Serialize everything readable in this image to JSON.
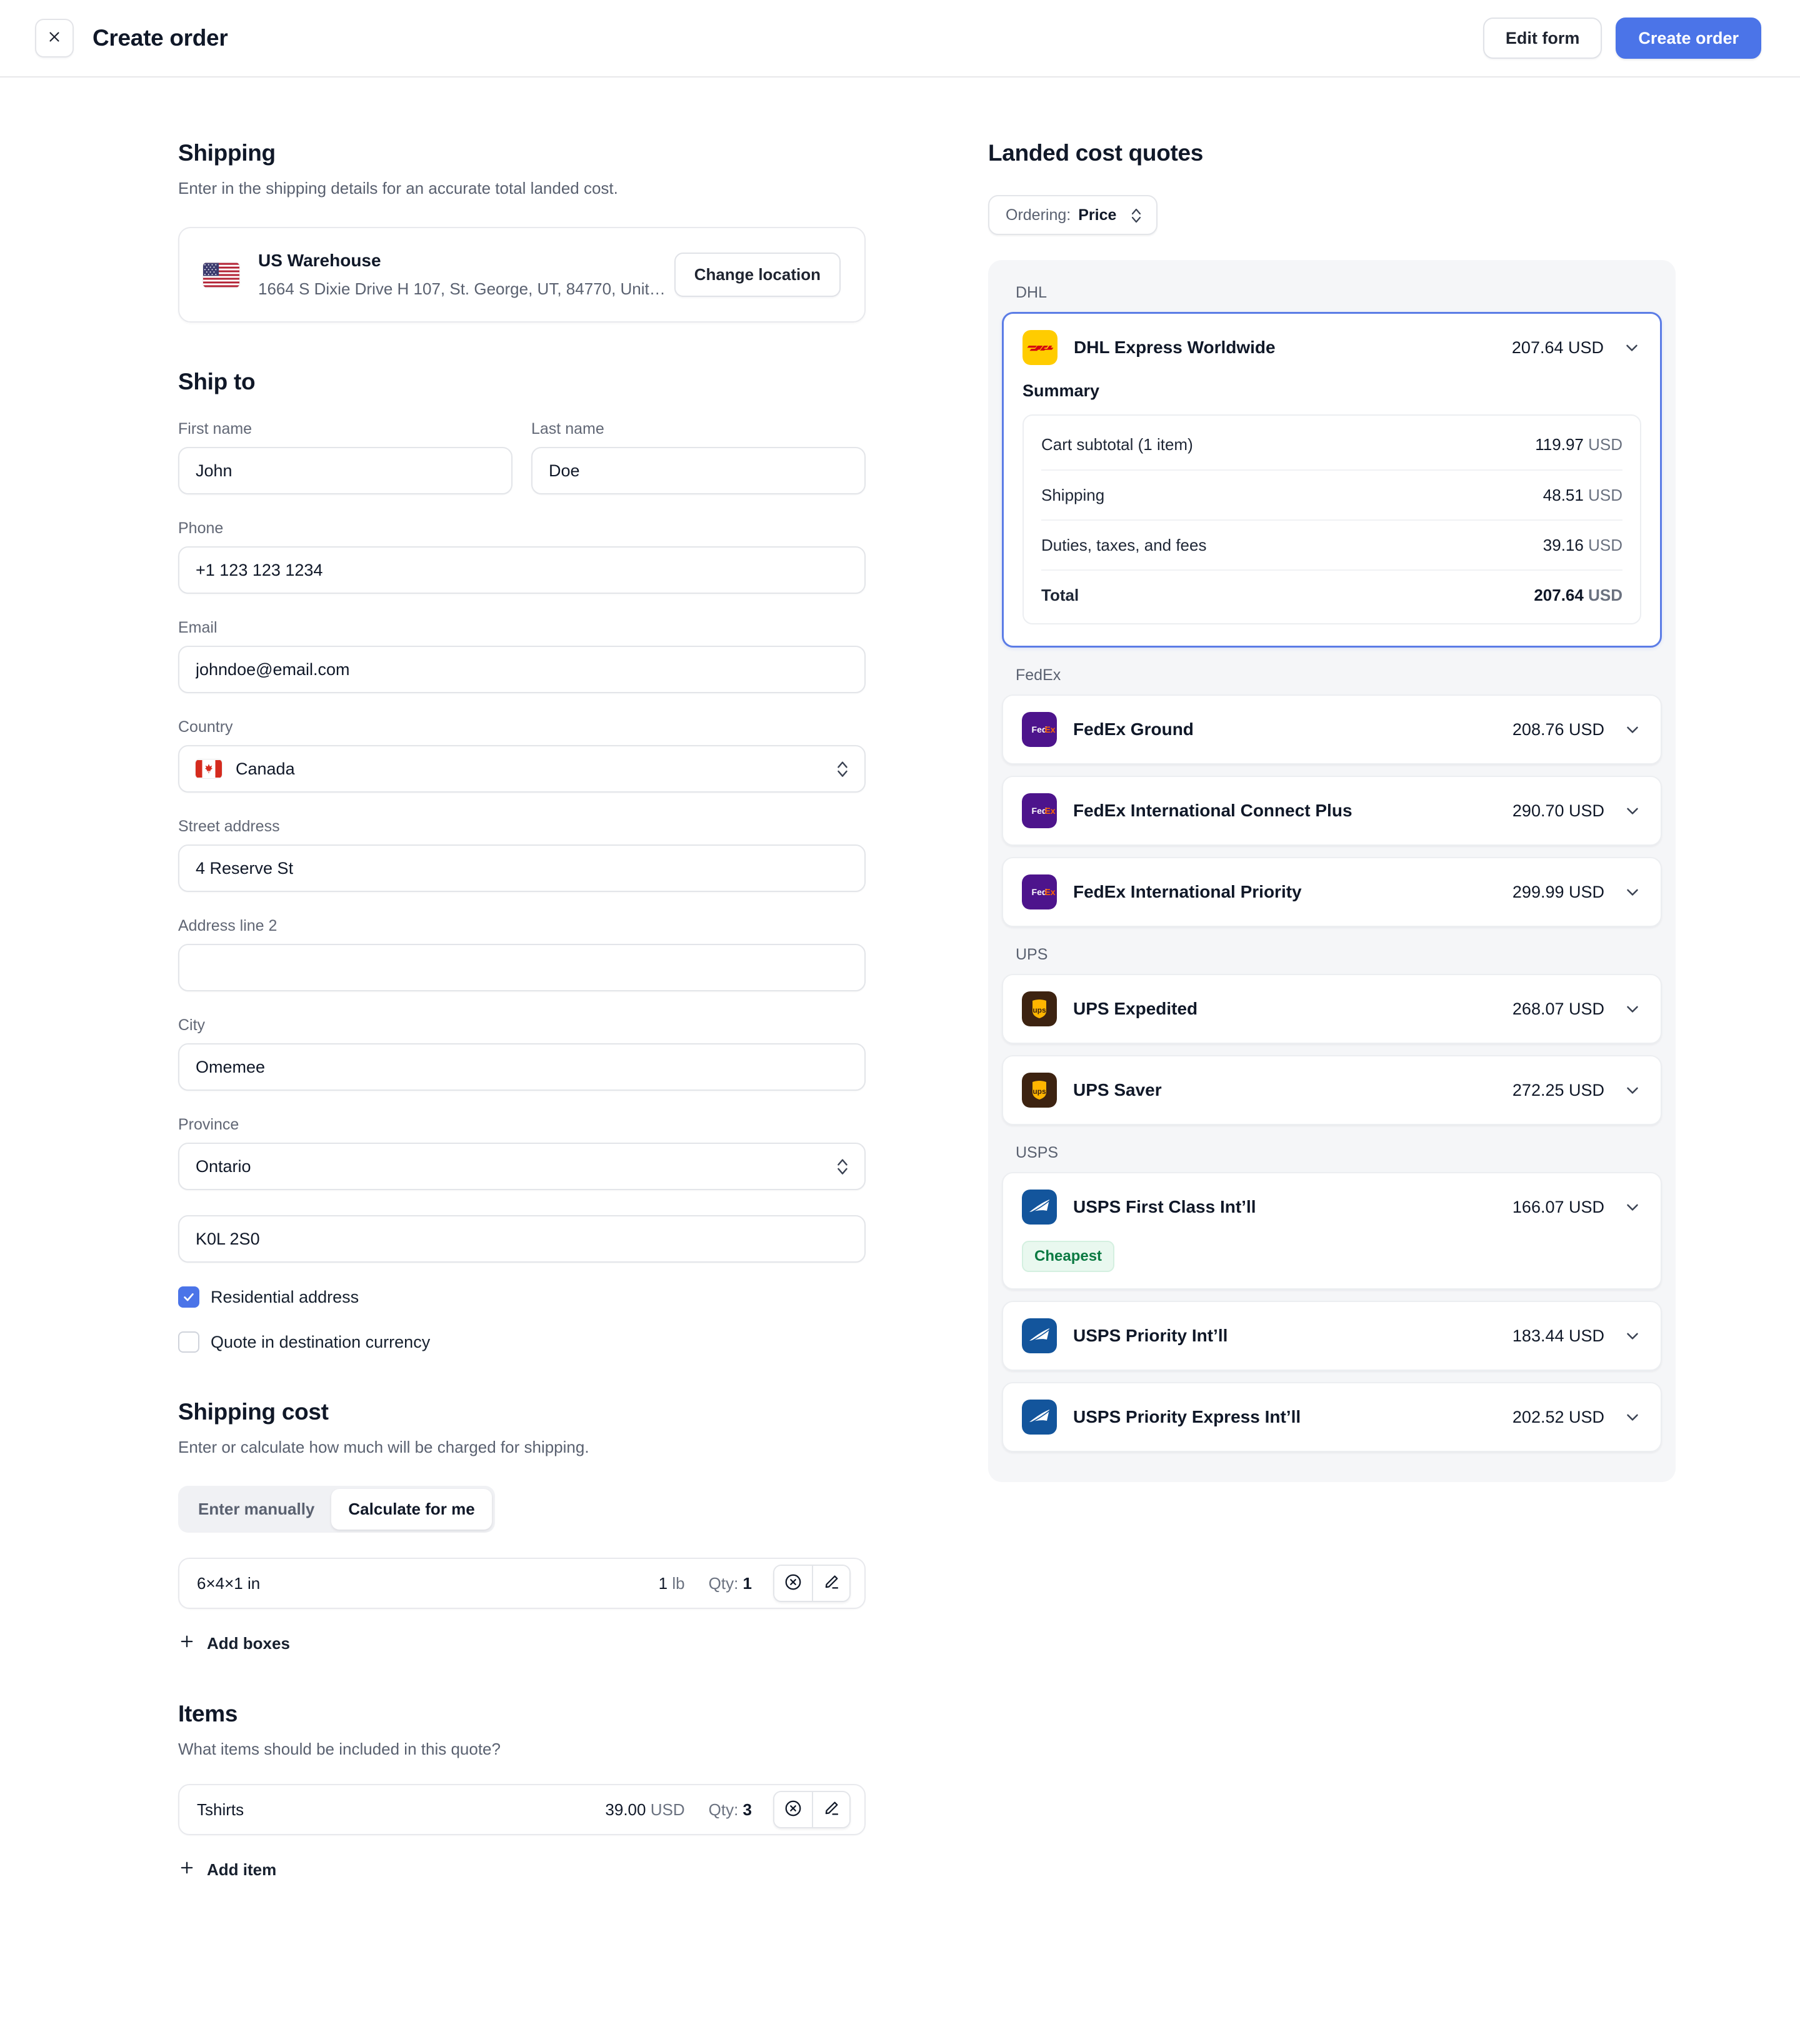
{
  "topbar": {
    "close_icon": "close-icon",
    "title": "Create order",
    "edit_form_label": "Edit form",
    "create_order_label": "Create order"
  },
  "shipping": {
    "title": "Shipping",
    "subtitle": "Enter in the shipping details for an accurate total landed cost.",
    "warehouse": {
      "flag": "us-flag",
      "name": "US Warehouse",
      "address": "1664 S Dixie Drive H 107, St. George, UT, 84770, Unit…",
      "change_label": "Change location"
    }
  },
  "ship_to": {
    "title": "Ship to",
    "first_name": {
      "label": "First name",
      "value": "John"
    },
    "last_name": {
      "label": "Last name",
      "value": "Doe"
    },
    "phone": {
      "label": "Phone",
      "value": "+1 123 123 1234"
    },
    "email": {
      "label": "Email",
      "value": "johndoe@email.com"
    },
    "country": {
      "label": "Country",
      "value": "Canada",
      "flag": "ca-flag"
    },
    "street": {
      "label": "Street address",
      "value": "4 Reserve St"
    },
    "address2": {
      "label": "Address line 2",
      "value": ""
    },
    "city": {
      "label": "City",
      "value": "Omemee"
    },
    "province": {
      "label": "Province",
      "value": "Ontario"
    },
    "postal": {
      "label": "",
      "value": "K0L 2S0"
    },
    "residential": {
      "label": "Residential address",
      "checked": true
    },
    "destination_currency": {
      "label": "Quote in destination currency",
      "checked": false
    }
  },
  "shipping_cost": {
    "title": "Shipping cost",
    "subtitle": "Enter or calculate how much will be charged for shipping.",
    "tabs": [
      {
        "label": "Enter manually",
        "active": false
      },
      {
        "label": "Calculate for me",
        "active": true
      }
    ],
    "boxes": [
      {
        "name": "6×4×1 in",
        "weight": "1",
        "weight_unit": "lb",
        "qty_label": "Qty:",
        "qty": "1"
      }
    ],
    "add_boxes_label": "Add boxes"
  },
  "items_section": {
    "title": "Items",
    "subtitle": "What items should be included in this quote?",
    "items": [
      {
        "name": "Tshirts",
        "price": "39.00",
        "currency": "USD",
        "qty_label": "Qty:",
        "qty": "3"
      }
    ],
    "add_item_label": "Add item"
  },
  "quotes": {
    "title": "Landed cost quotes",
    "ordering": {
      "label": "Ordering:",
      "value": "Price"
    },
    "groups": [
      {
        "carrier": "DHL",
        "logo": "dhl-logo",
        "rates": [
          {
            "name": "DHL Express Worldwide",
            "price": "207.64 USD",
            "selected": true,
            "badge": null,
            "summary": {
              "title": "Summary",
              "rows": [
                {
                  "label": "Cart subtotal (1 item)",
                  "amount": "119.97",
                  "currency": "USD",
                  "total": false
                },
                {
                  "label": "Shipping",
                  "amount": "48.51",
                  "currency": "USD",
                  "total": false
                },
                {
                  "label": "Duties, taxes, and fees",
                  "amount": "39.16",
                  "currency": "USD",
                  "total": false
                },
                {
                  "label": "Total",
                  "amount": "207.64",
                  "currency": "USD",
                  "total": true
                }
              ]
            }
          }
        ]
      },
      {
        "carrier": "FedEx",
        "logo": "fedex-logo",
        "rates": [
          {
            "name": "FedEx Ground",
            "price": "208.76 USD",
            "selected": false,
            "badge": null
          },
          {
            "name": "FedEx International Connect Plus",
            "price": "290.70 USD",
            "selected": false,
            "badge": null
          },
          {
            "name": "FedEx International Priority",
            "price": "299.99 USD",
            "selected": false,
            "badge": null
          }
        ]
      },
      {
        "carrier": "UPS",
        "logo": "ups-logo",
        "rates": [
          {
            "name": "UPS Expedited",
            "price": "268.07 USD",
            "selected": false,
            "badge": null
          },
          {
            "name": "UPS Saver",
            "price": "272.25 USD",
            "selected": false,
            "badge": null
          }
        ]
      },
      {
        "carrier": "USPS",
        "logo": "usps-logo",
        "rates": [
          {
            "name": "USPS First Class Int’ll",
            "price": "166.07 USD",
            "selected": false,
            "badge": "Cheapest"
          },
          {
            "name": "USPS Priority Int’ll",
            "price": "183.44 USD",
            "selected": false,
            "badge": null
          },
          {
            "name": "USPS Priority Express Int’ll",
            "price": "202.52 USD",
            "selected": false,
            "badge": null
          }
        ]
      }
    ]
  },
  "colors": {
    "accent": "#4b74e8",
    "selected_border": "#5b7ce6",
    "panel_bg": "#f5f6f8",
    "badge_text": "#0b7a42",
    "badge_bg": "#e9f8ef",
    "dhl_yellow": "#ffcc00",
    "dhl_red": "#d40511",
    "fedex_purple": "#4d148c",
    "ups_brown": "#3d2311",
    "ups_gold": "#ffb500",
    "usps_blue": "#13559c"
  }
}
